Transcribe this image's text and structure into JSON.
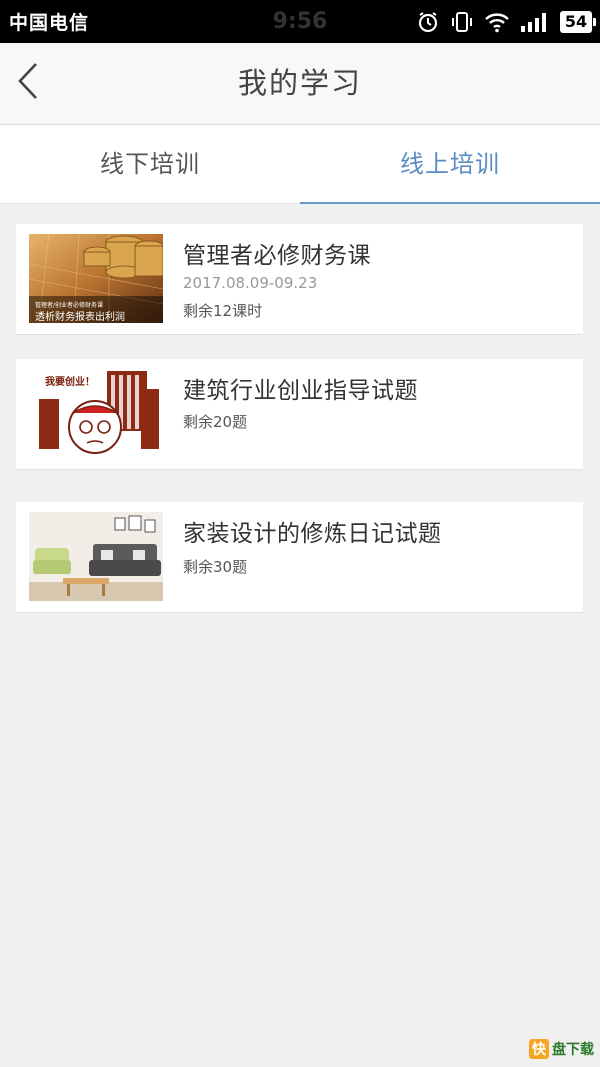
{
  "status_bar": {
    "carrier": "中国电信",
    "time": "9:56",
    "battery": "54"
  },
  "header": {
    "title": "我的学习"
  },
  "tabs": [
    {
      "label": "线下培训",
      "active": false
    },
    {
      "label": "线上培训",
      "active": true
    }
  ],
  "courses": [
    {
      "title": "管理者必修财务课",
      "date": "2017.08.09-09.23",
      "remaining": "剩余12课时",
      "thumb_caption_small": "管理者/创业者必修财务课",
      "thumb_caption": "透析财务报表出利润"
    },
    {
      "title": "建筑行业创业指导试题",
      "remaining": "剩余20题",
      "thumb_caption": "我要创业！"
    },
    {
      "title": "家装设计的修炼日记试题",
      "remaining": "剩余30题"
    }
  ],
  "watermark": {
    "logo": "快",
    "text": "盘下载"
  },
  "colors": {
    "accent": "#5a8bc2",
    "background": "#f0f0f0"
  }
}
